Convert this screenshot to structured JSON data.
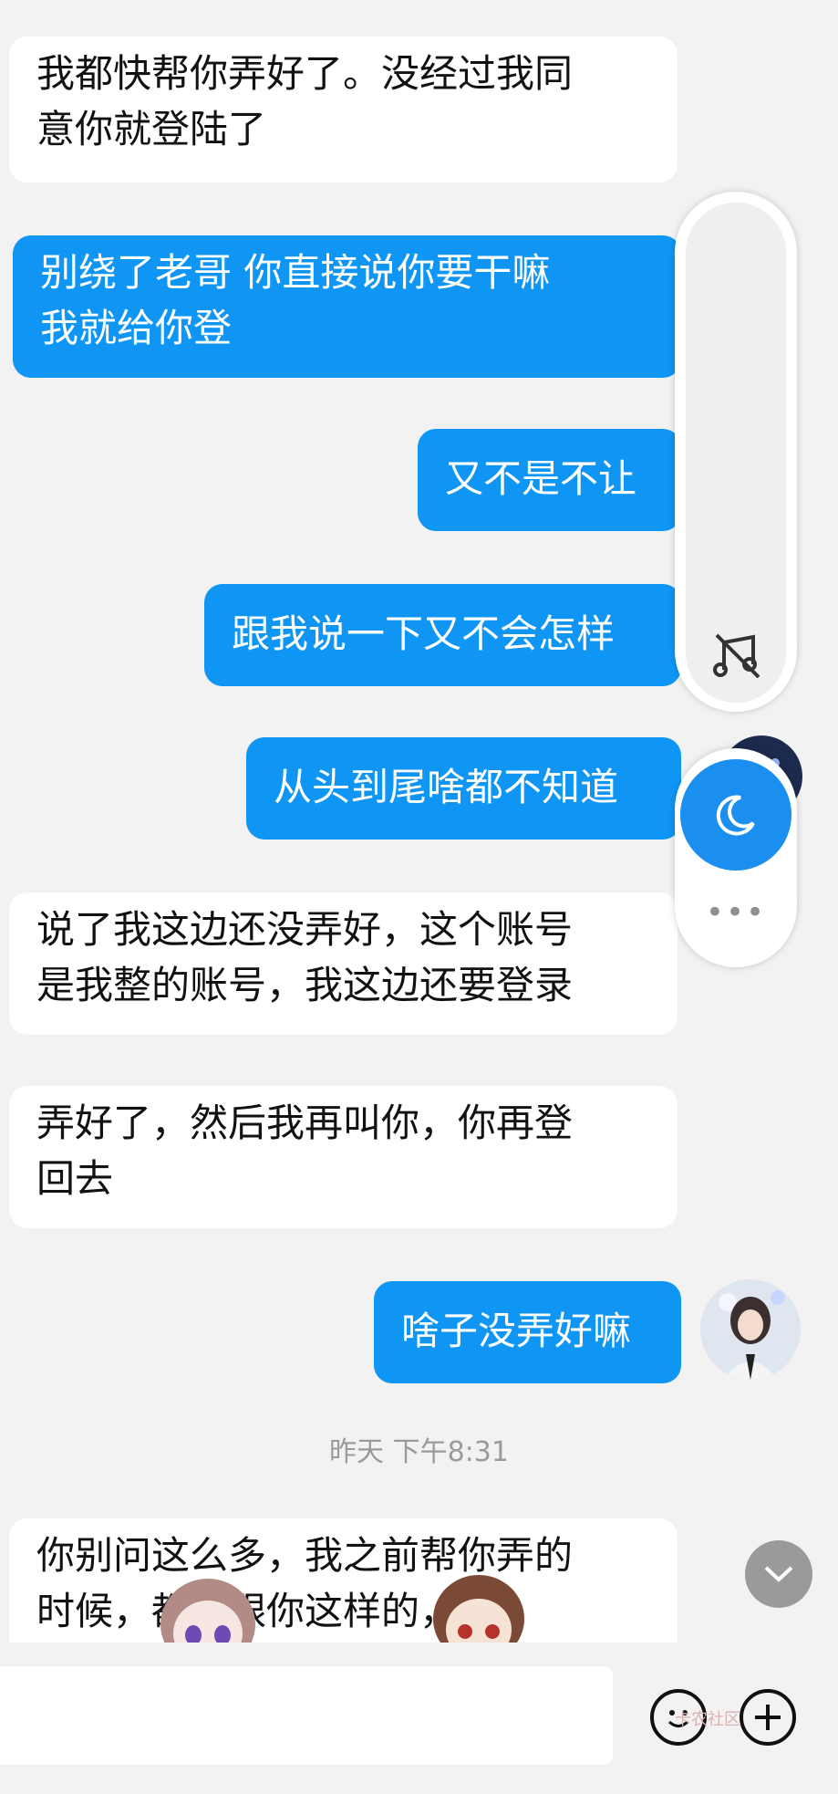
{
  "messages": [
    {
      "from": "other",
      "lines": [
        "我都快帮你弄好了。没经过我同",
        "意你就登陆了"
      ]
    },
    {
      "from": "me",
      "lines": [
        "别绕了老哥 你直接说你要干嘛",
        "我就给你登"
      ]
    },
    {
      "from": "me",
      "lines": [
        "又不是不让"
      ]
    },
    {
      "from": "me",
      "lines": [
        "跟我说一下又不会怎样"
      ]
    },
    {
      "from": "me",
      "lines": [
        "从头到尾啥都不知道"
      ]
    },
    {
      "from": "other",
      "lines": [
        "说了我这边还没弄好，这个账号",
        "是我整的账号，我这边还要登录"
      ]
    },
    {
      "from": "other",
      "lines": [
        "弄好了，然后我再叫你，你再登",
        "回去"
      ]
    },
    {
      "from": "me",
      "lines": [
        "啥子没弄好嘛"
      ]
    },
    {
      "from": "other",
      "lines": [
        "你别问这么多，我之前帮你弄的",
        "时候，都是跟你这样的，别"
      ]
    }
  ],
  "timestamp": "昨天 下午8:31",
  "tools": {
    "music_icon": "music-off-icon",
    "moon_icon": "moon-icon",
    "more_label": "•••"
  },
  "input": {
    "placeholder": ""
  },
  "watermark": "卡农社区",
  "colors": {
    "outgoing": "#0f96f5",
    "incoming": "#ffffff",
    "background": "#f2f2f2"
  }
}
